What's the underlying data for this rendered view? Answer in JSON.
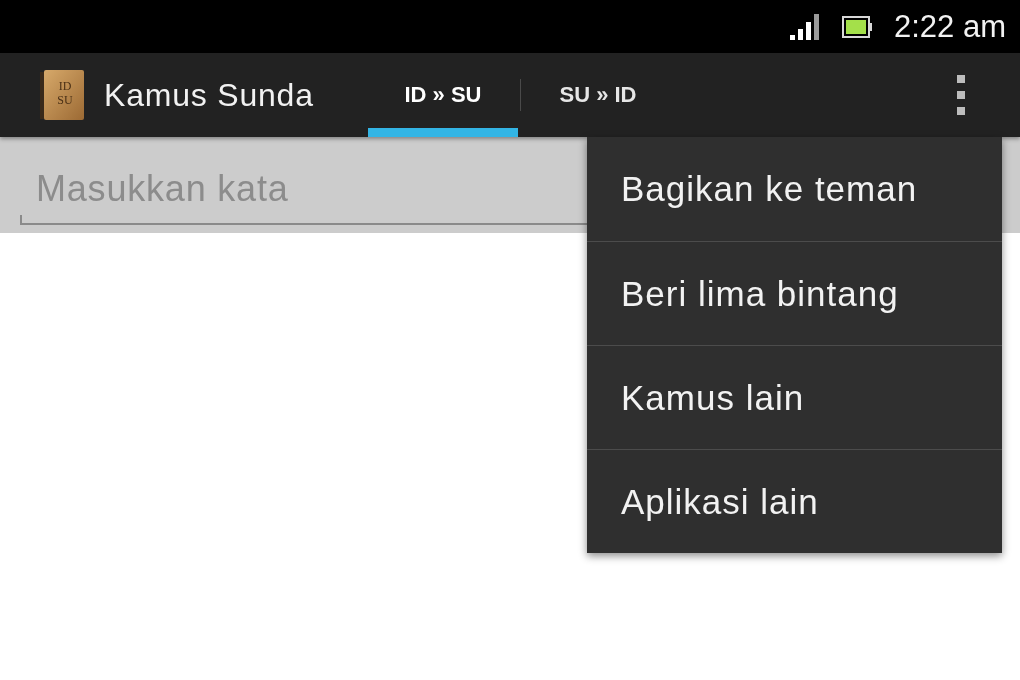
{
  "status_bar": {
    "time": "2:22 am"
  },
  "app_bar": {
    "icon_lines": [
      "ID",
      "SU"
    ],
    "title": "Kamus Sunda",
    "tabs": [
      {
        "label": "ID » SU",
        "selected": true
      },
      {
        "label": "SU » ID",
        "selected": false
      }
    ]
  },
  "search": {
    "placeholder": "Masukkan kata"
  },
  "overflow_menu": {
    "items": [
      "Bagikan ke teman",
      "Beri lima bintang",
      "Kamus lain",
      "Aplikasi lain"
    ]
  }
}
